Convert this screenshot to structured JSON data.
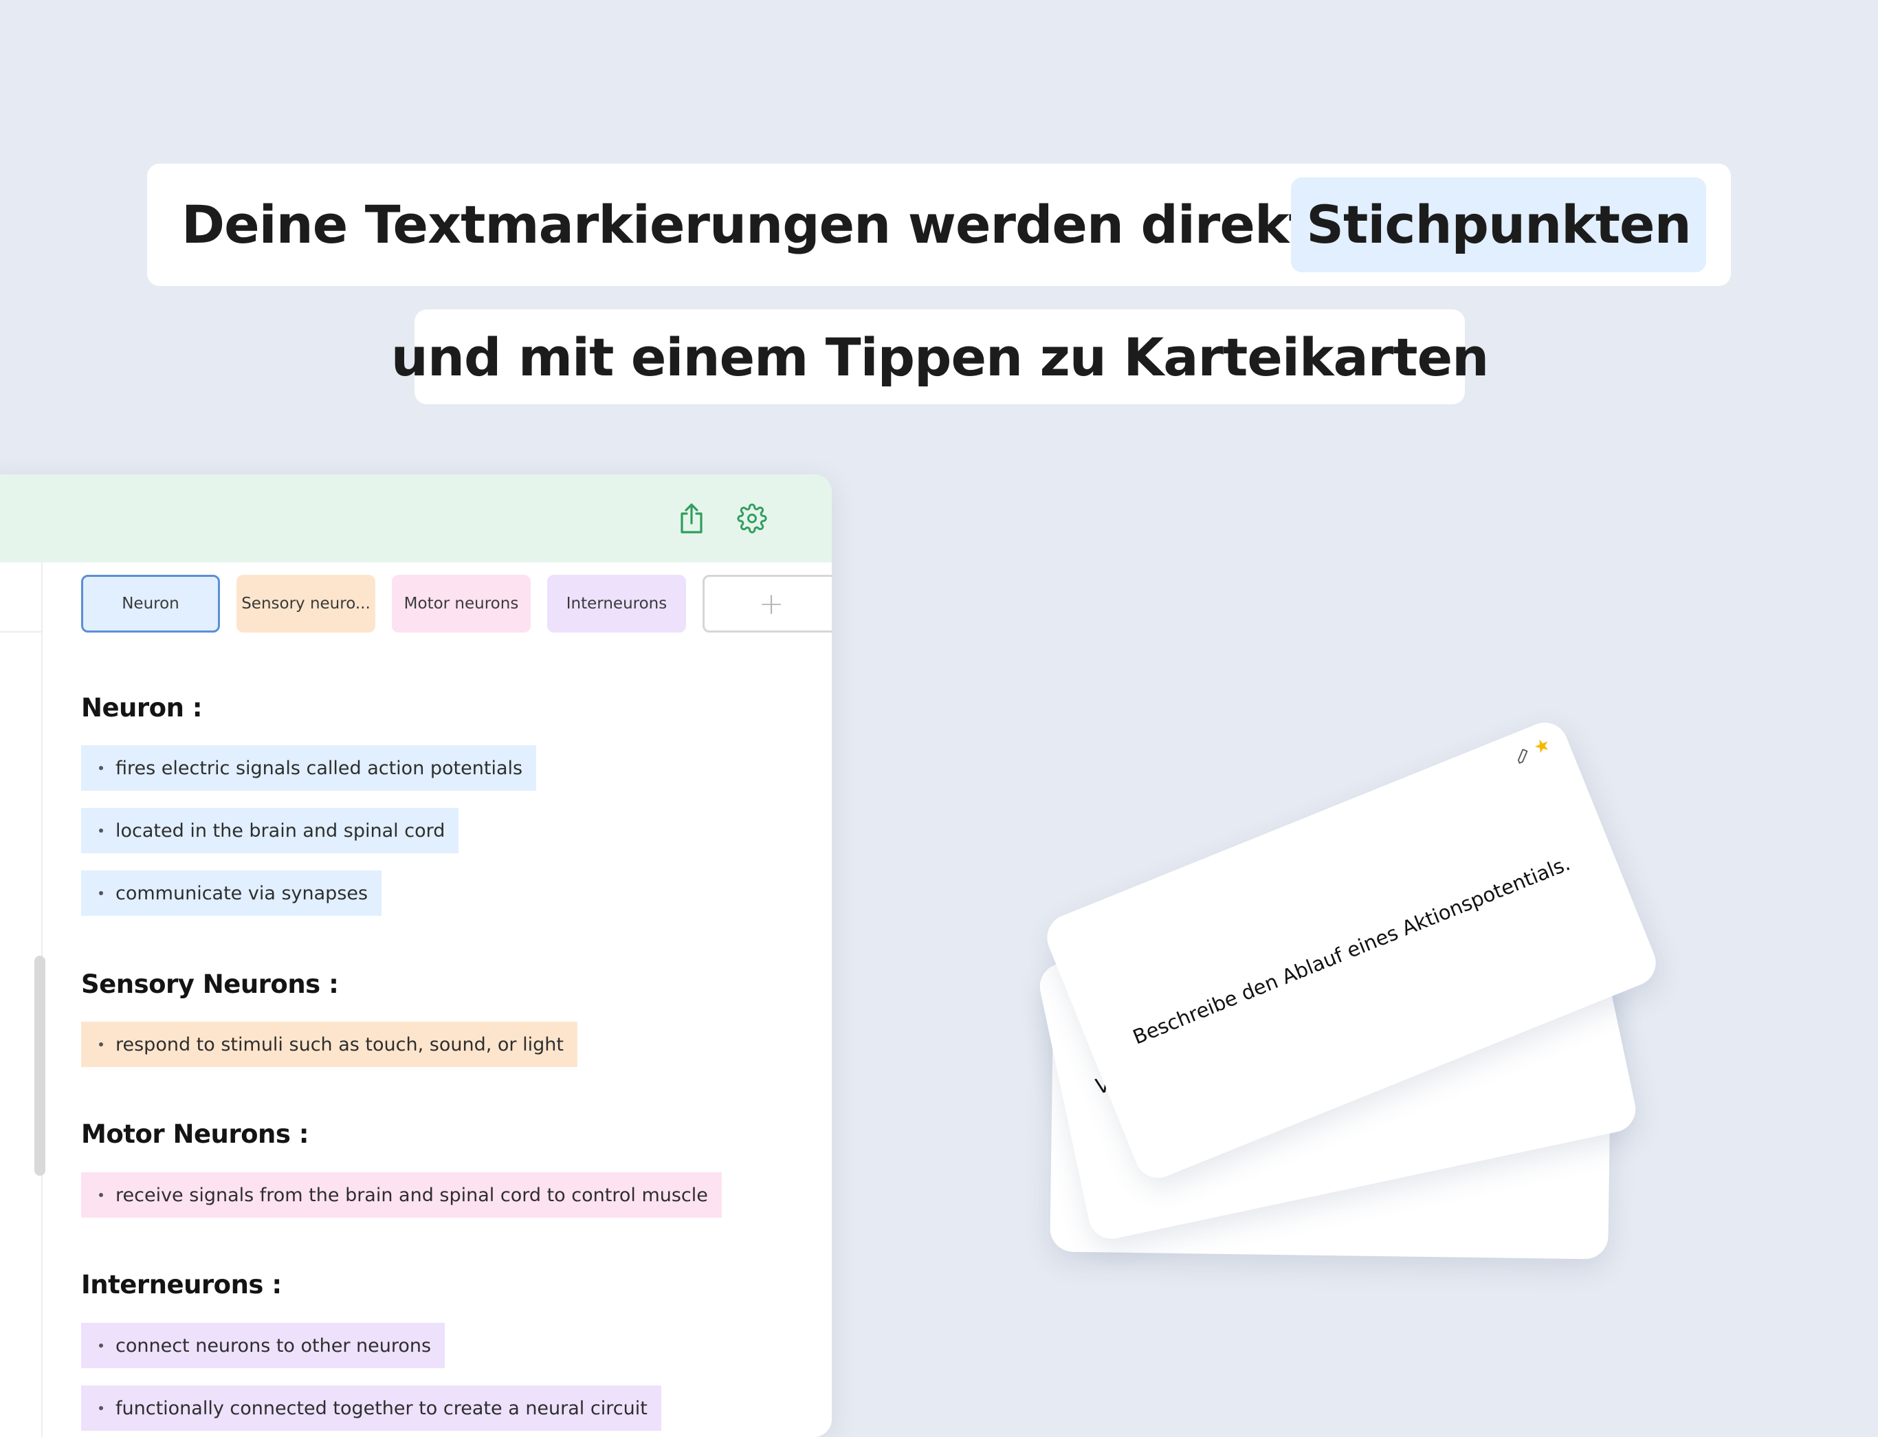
{
  "headline": {
    "line1_text": "Deine Textmarkierungen werden direkt zu",
    "line1_highlight": "Stichpunkten",
    "line2_text": "und mit einem Tippen zu Karteikarten"
  },
  "toolbar": {
    "share_icon": "share-icon",
    "settings_icon": "gear-icon",
    "accent_color": "#2f9e5e"
  },
  "tabs": [
    {
      "label": "Neuron",
      "color": "#e1effe",
      "selected": true
    },
    {
      "label": "Sensory neuro...",
      "color": "#fde5cd"
    },
    {
      "label": "Motor neurons",
      "color": "#fde2f1"
    },
    {
      "label": "Interneurons",
      "color": "#ede1fc"
    },
    {
      "label": "+",
      "icon": "plus-icon"
    }
  ],
  "sections": [
    {
      "title": "Neuron :",
      "color": "#e1effe",
      "items": [
        "fires electric signals called action potentials",
        "located in the brain and spinal cord",
        "communicate via synapses"
      ]
    },
    {
      "title": "Sensory Neurons :",
      "color": "#fde5cd",
      "items": [
        "respond to stimuli such as touch, sound, or light"
      ]
    },
    {
      "title": "Motor Neurons :",
      "color": "#fde2f1",
      "items": [
        "receive signals from the brain and spinal cord to control muscle"
      ]
    },
    {
      "title": "Interneurons :",
      "color": "#ede1fc",
      "items": [
        "connect neurons to other neurons",
        "functionally connected together to create a neural circuit"
      ]
    }
  ],
  "flashcards": {
    "front_question": "Beschreibe den Ablauf eines Aktionspotentials.",
    "second_card_peek": "V",
    "icons": [
      "pencil-icon",
      "star-icon"
    ],
    "star_color": "#f5b800"
  }
}
